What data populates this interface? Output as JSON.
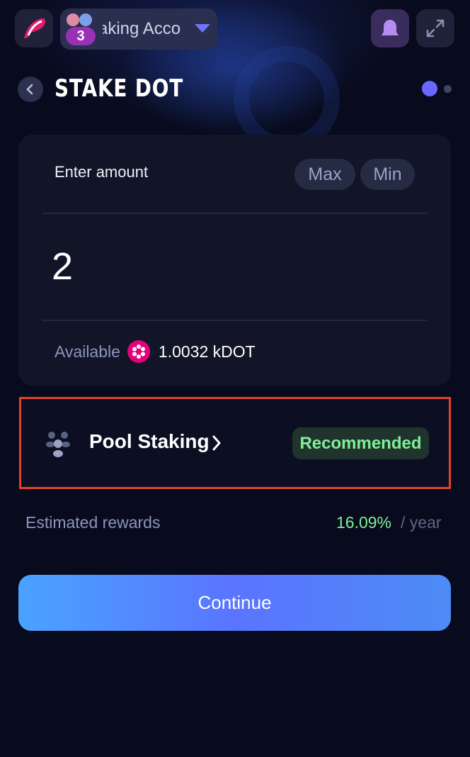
{
  "header": {
    "account_name": "aking Acco",
    "account_count": "3",
    "caret_color": "#6d74ff"
  },
  "title_bar": {
    "title": "STAKE DOT",
    "step_current": 1,
    "step_total": 2
  },
  "amount_card": {
    "enter_label": "Enter amount",
    "max_label": "Max",
    "min_label": "Min",
    "amount_value": "2",
    "available_label": "Available",
    "available_value": "1.0032 kDOT",
    "token_icon": "polkadot-icon",
    "token_color": "#e6007a"
  },
  "staking_option": {
    "label": "Pool Staking",
    "badge": "Recommended",
    "icon": "pool-users-icon",
    "highlight_color": "#e6402a"
  },
  "rewards": {
    "label": "Estimated rewards",
    "value": "16.09%",
    "unit": "/ year"
  },
  "continue_label": "Continue"
}
